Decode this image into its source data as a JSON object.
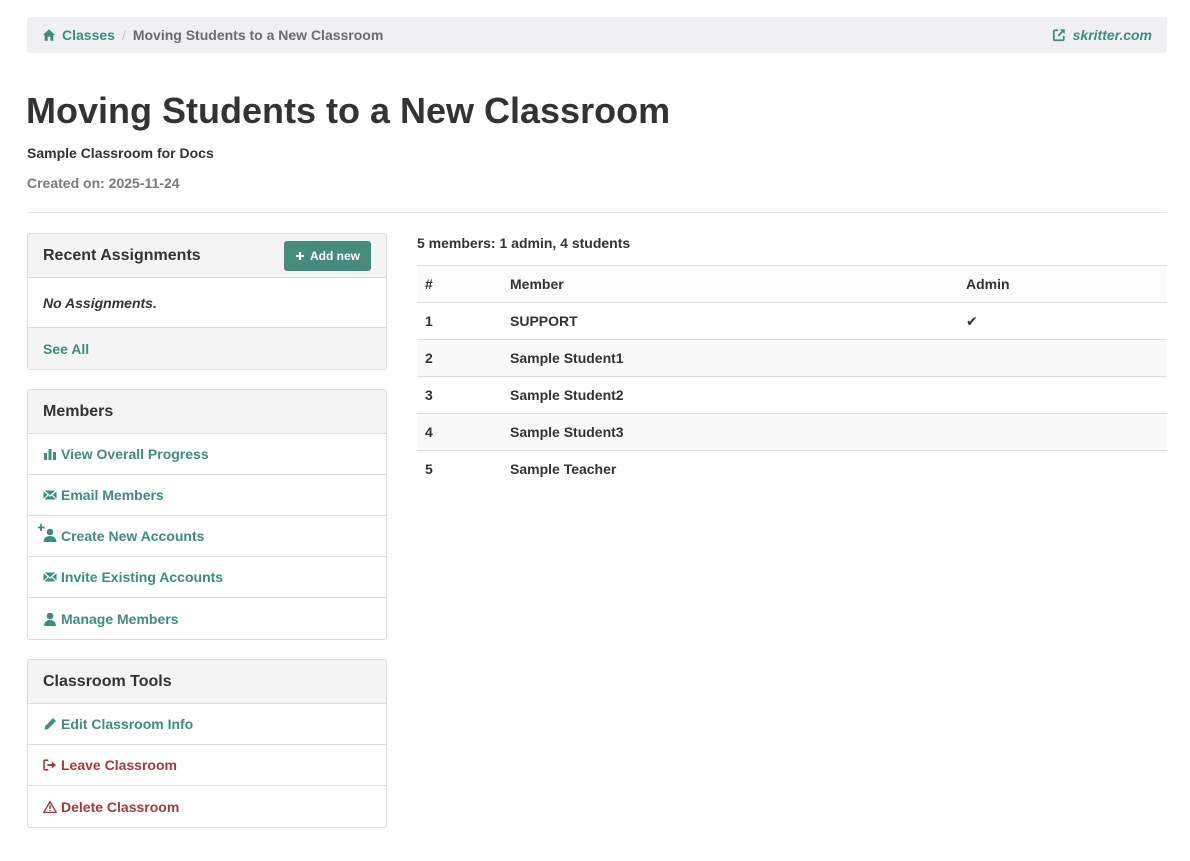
{
  "breadcrumb": {
    "home_label": "Classes",
    "separator": "/",
    "current": "Moving Students to a New Classroom",
    "external_link": "skritter.com"
  },
  "header": {
    "title": "Moving Students to a New Classroom",
    "classroom_name": "Sample Classroom for Docs",
    "created": "Created on: 2025-11-24"
  },
  "assignments": {
    "title": "Recent Assignments",
    "add_label": "Add new",
    "empty_text": "No Assignments.",
    "see_all": "See All"
  },
  "members_panel": {
    "title": "Members",
    "items": [
      {
        "label": "View Overall Progress",
        "icon": "bar-chart-icon"
      },
      {
        "label": "Email Members",
        "icon": "envelope-icon"
      },
      {
        "label": "Create New Accounts",
        "icon": "add-user-icon"
      },
      {
        "label": "Invite Existing Accounts",
        "icon": "envelope-icon"
      },
      {
        "label": "Manage Members",
        "icon": "user-icon"
      }
    ]
  },
  "tools_panel": {
    "title": "Classroom Tools",
    "items": [
      {
        "label": "Edit Classroom Info",
        "icon": "pencil-icon"
      },
      {
        "label": "Leave Classroom",
        "icon": "sign-out-icon"
      },
      {
        "label": "Delete Classroom",
        "icon": "warning-icon"
      }
    ]
  },
  "members_table": {
    "summary": "5 members: 1 admin, 4 students",
    "headers": [
      "#",
      "Member",
      "Admin"
    ],
    "rows": [
      {
        "num": "1",
        "name": "SUPPORT",
        "admin": "✔"
      },
      {
        "num": "2",
        "name": "Sample Student1",
        "admin": ""
      },
      {
        "num": "3",
        "name": "Sample Student2",
        "admin": ""
      },
      {
        "num": "4",
        "name": "Sample Student3",
        "admin": ""
      },
      {
        "num": "5",
        "name": "Sample Teacher",
        "admin": ""
      }
    ]
  },
  "colors": {
    "accent": "#3f8b7f",
    "button": "#468c7e",
    "danger": "#9c3d3d"
  }
}
